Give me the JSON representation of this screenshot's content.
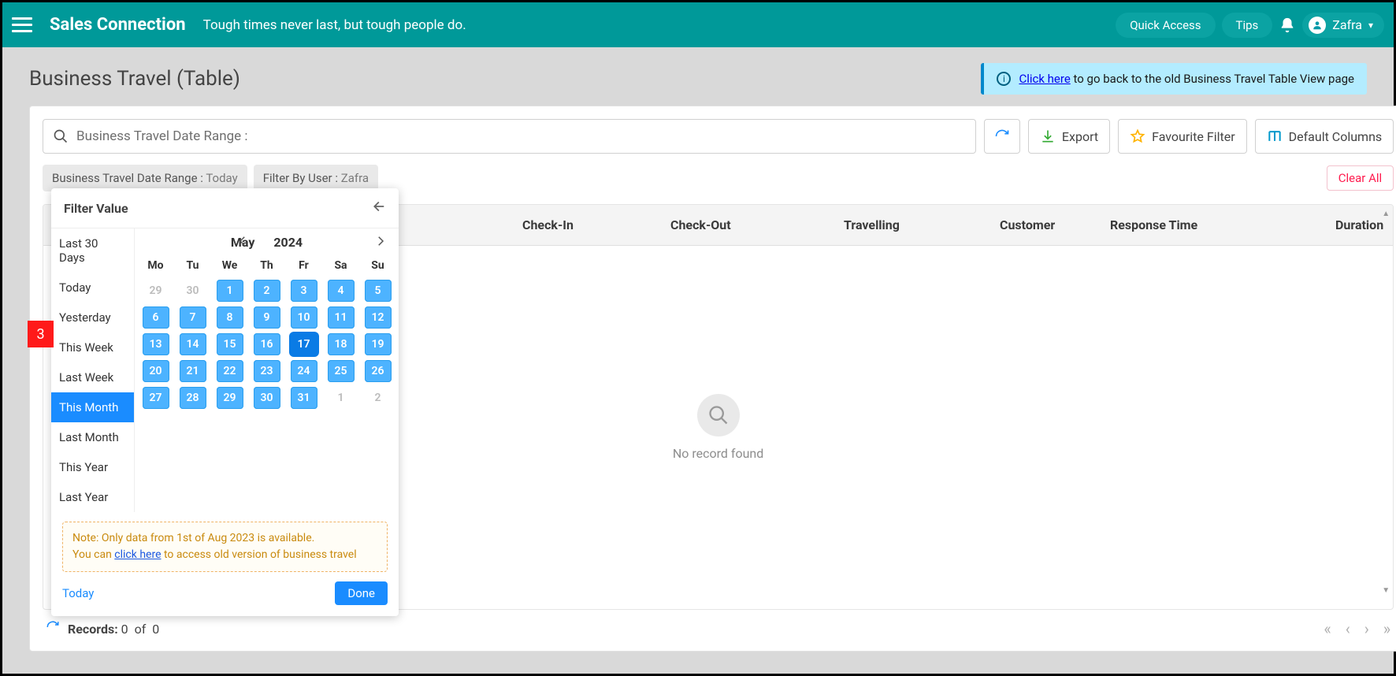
{
  "brand": "Sales Connection",
  "tagline": "Tough times never last, but tough people do.",
  "topbar": {
    "quick": "Quick Access",
    "tips": "Tips",
    "user": "Zafra"
  },
  "page": {
    "title": "Business Travel (Table)"
  },
  "alert": {
    "link": "Click here",
    "rest": " to go back to the old Business Travel Table View page"
  },
  "toolbar": {
    "search_label": "Business Travel Date Range :",
    "export": "Export",
    "favfilter": "Favourite Filter",
    "defcols": "Default Columns"
  },
  "chips": {
    "ch1_label": "Business Travel Date Range :",
    "ch1_value": " Today",
    "ch2_label": "Filter By User :",
    "ch2_value": " Zafra",
    "clear": "Clear All"
  },
  "cols": {
    "checkin": "Check-In",
    "checkout": "Check-Out",
    "travel": "Travelling",
    "cust": "Customer",
    "resp": "Response Time",
    "dur": "Duration"
  },
  "empty": "No record found",
  "footer": {
    "records_label": "Records:",
    "r1": "0",
    "of": "of",
    "r2": "0"
  },
  "popup": {
    "title": "Filter Value",
    "ranges": [
      "Last 30 Days",
      "Today",
      "Yesterday",
      "This Week",
      "Last Week",
      "This Month",
      "Last Month",
      "This Year",
      "Last Year"
    ],
    "active_range": "This Month",
    "month": "May",
    "year": "2024",
    "dow": [
      "Mo",
      "Tu",
      "We",
      "Th",
      "Fr",
      "Sa",
      "Su"
    ],
    "prev": [
      "29",
      "30"
    ],
    "days": [
      "1",
      "2",
      "3",
      "4",
      "5",
      "6",
      "7",
      "8",
      "9",
      "10",
      "11",
      "12",
      "13",
      "14",
      "15",
      "16",
      "17",
      "18",
      "19",
      "20",
      "21",
      "22",
      "23",
      "24",
      "25",
      "26",
      "27",
      "28",
      "29",
      "30",
      "31"
    ],
    "next": [
      "1",
      "2"
    ],
    "today_num": "17",
    "note1": "Note: Only data from 1st of Aug 2023 is available.",
    "note2a": "You can ",
    "note2link": "click here",
    "note2b": " to access old version of business travel",
    "today_link": "Today",
    "done": "Done"
  },
  "badge": "3"
}
